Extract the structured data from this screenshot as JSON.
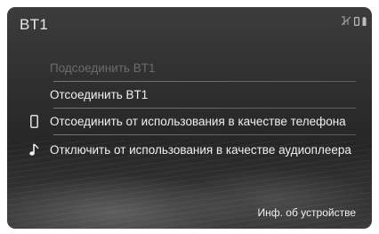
{
  "header": {
    "title": "BT1",
    "status_icons": [
      "mute-icon",
      "phone-status-icon",
      "battery-icon"
    ]
  },
  "menu": {
    "items": [
      {
        "label": "Подсоединить BT1",
        "enabled": false,
        "icon": ""
      },
      {
        "label": "Отсоединить BT1",
        "enabled": true,
        "icon": ""
      },
      {
        "label": "Отсоединить от использования в качестве телефона",
        "enabled": true,
        "icon": "phone-icon"
      },
      {
        "label": "Отключить от использования в качестве аудиоплеера",
        "enabled": true,
        "icon": "music-note-icon"
      }
    ]
  },
  "footer": {
    "device_info_label": "Инф. об устройстве"
  },
  "colors": {
    "background": "#2e2e2e",
    "text": "#f0f0f0",
    "disabled_text": "#6c6c6c"
  }
}
